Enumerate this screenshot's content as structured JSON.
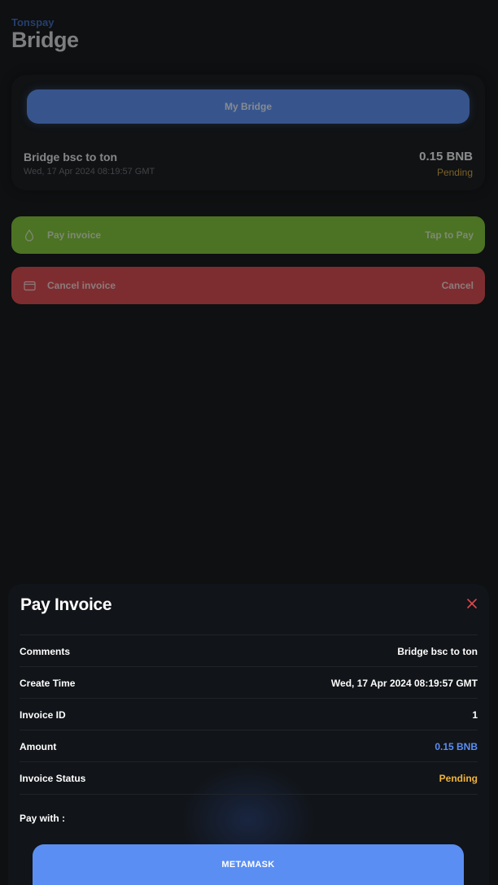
{
  "header": {
    "app_name": "Tonspay",
    "title": "Bridge"
  },
  "bridge_card": {
    "button_label": "My Bridge",
    "item": {
      "name": "Bridge bsc to ton",
      "date": "Wed, 17 Apr 2024 08:19:57 GMT",
      "amount": "0.15 BNB",
      "status": "Pending"
    }
  },
  "actions": {
    "pay": {
      "label": "Pay invoice",
      "right": "Tap to Pay",
      "icon": "drop-icon"
    },
    "cancel": {
      "label": "Cancel invoice",
      "right": "Cancel",
      "icon": "card-icon"
    }
  },
  "sheet": {
    "title": "Pay Invoice",
    "rows": [
      {
        "label": "Comments",
        "value": "Bridge bsc to ton"
      },
      {
        "label": "Create Time",
        "value": "Wed, 17 Apr 2024 08:19:57 GMT"
      },
      {
        "label": "Invoice ID",
        "value": "1"
      },
      {
        "label": "Amount",
        "value": "0.15 BNB"
      },
      {
        "label": "Invoice Status",
        "value": "Pending"
      }
    ],
    "pay_with_label": "Pay with :",
    "metamask_label": "METAMASK"
  },
  "colors": {
    "accent": "#5a8ef2",
    "pay": "#7fc332",
    "cancel": "#d8464a",
    "pending": "#f0b43c",
    "close": "#e0474c"
  }
}
